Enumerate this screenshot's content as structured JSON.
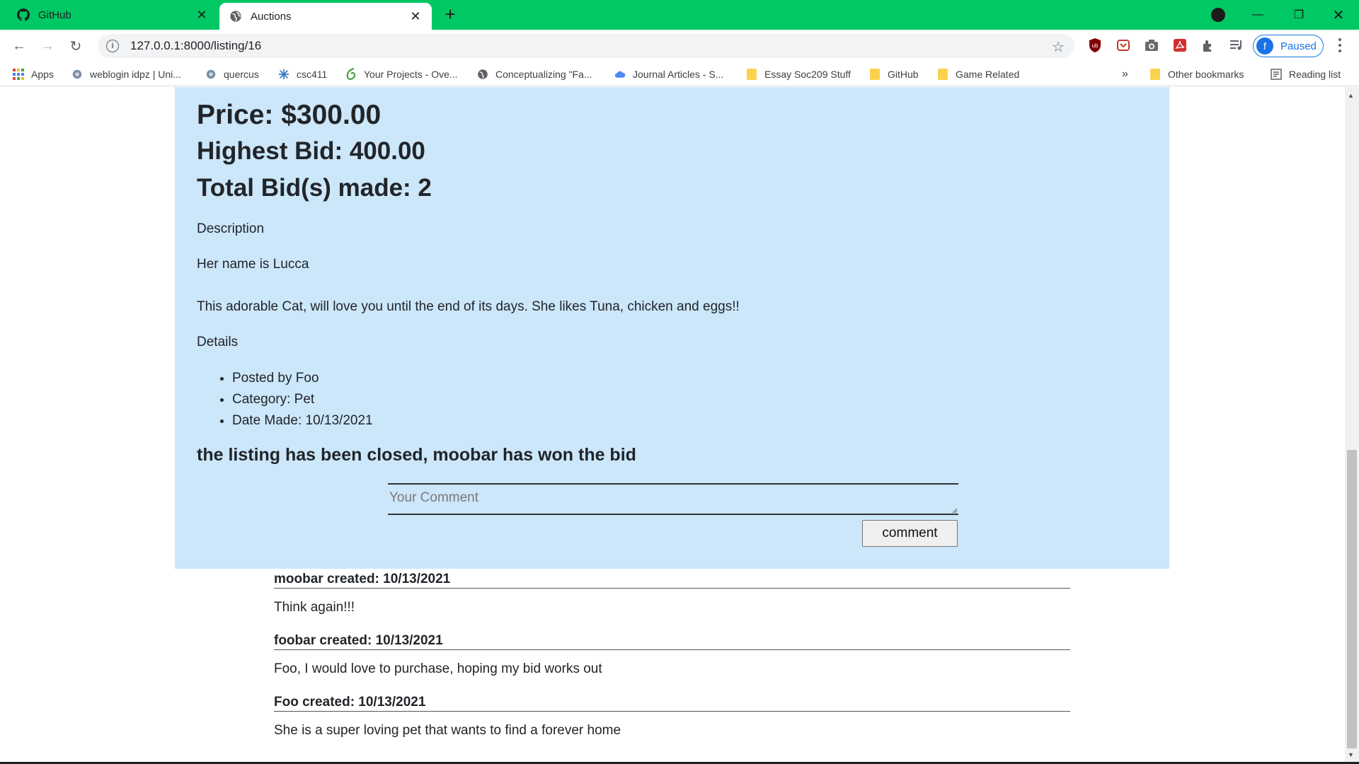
{
  "browser": {
    "tabs": [
      {
        "title": "GitHub",
        "icon": "github-icon",
        "active": false
      },
      {
        "title": "Auctions",
        "icon": "globe-icon",
        "active": true
      }
    ],
    "url": "127.0.0.1:8000/listing/16",
    "profile_status": "Paused",
    "profile_initial": "f",
    "bookmarks": [
      {
        "label": "Apps",
        "icon": "apps-grid-icon"
      },
      {
        "label": "weblogin idpz | Uni...",
        "icon": "weblogin-icon"
      },
      {
        "label": "quercus",
        "icon": "quercus-icon"
      },
      {
        "label": "csc411",
        "icon": "csc411-icon"
      },
      {
        "label": "Your Projects - Ove...",
        "icon": "overleaf-icon"
      },
      {
        "label": "Conceptualizing \"Fa...",
        "icon": "globe-icon"
      },
      {
        "label": "Journal Articles - S...",
        "icon": "cloud-icon"
      },
      {
        "label": "Essay Soc209 Stuff",
        "icon": "folder-icon"
      },
      {
        "label": "GitHub",
        "icon": "folder-icon"
      },
      {
        "label": "Game Related",
        "icon": "folder-icon"
      }
    ],
    "bookmarks_overflow": "»",
    "other_bookmarks": "Other bookmarks",
    "reading_list": "Reading list"
  },
  "listing": {
    "price": "Price: $300.00",
    "highest_bid": "Highest Bid: 400.00",
    "total_bids": "Total Bid(s) made: 2",
    "description_heading": "Description",
    "description_name": "Her name is Lucca",
    "description_text": "This adorable Cat, will love you until the end of its days. She likes Tuna, chicken and eggs!!",
    "details_heading": "Details",
    "details": [
      "Posted by Foo",
      "Category: Pet",
      "Date Made: 10/13/2021"
    ],
    "closed_message": "the listing has been closed, moobar has won the bid",
    "comment_placeholder": "Your Comment",
    "comment_button": "comment"
  },
  "comments": [
    {
      "header": "moobar created: 10/13/2021",
      "body": "Think again!!!"
    },
    {
      "header": "foobar created: 10/13/2021",
      "body": "Foo, I would love to purchase, hoping my bid works out"
    },
    {
      "header": "Foo created: 10/13/2021",
      "body": "She is a super loving pet that wants to find a forever home"
    }
  ],
  "colors": {
    "tabbar": "#00c864",
    "listing_bg": "#cce6fa",
    "accent": "#1a73e8"
  }
}
